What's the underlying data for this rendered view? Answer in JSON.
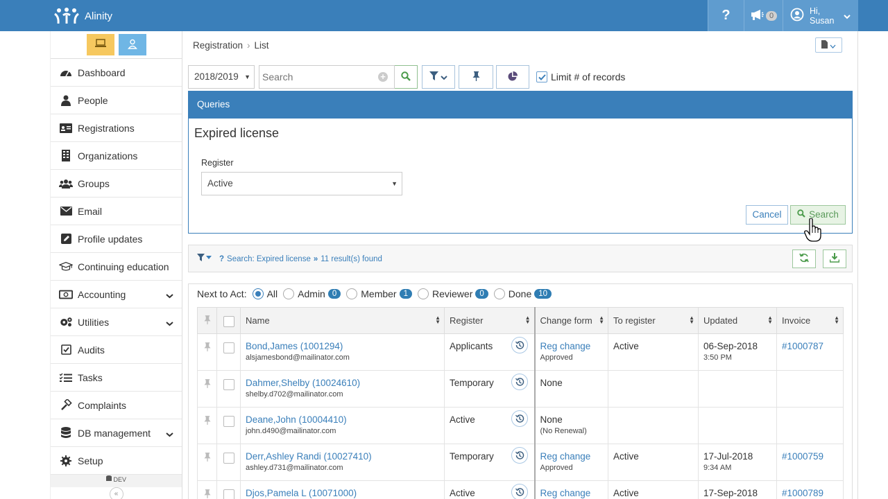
{
  "app": {
    "name": "Alinity"
  },
  "topbar": {
    "help_label": "?",
    "notif_count": "0",
    "user_greeting_1": "Hi,",
    "user_greeting_2": "Susan"
  },
  "sidebar": {
    "items": [
      {
        "label": "Dashboard",
        "icon": "dashboard-icon"
      },
      {
        "label": "People",
        "icon": "person-icon"
      },
      {
        "label": "Registrations",
        "icon": "id-card-icon"
      },
      {
        "label": "Organizations",
        "icon": "building-icon"
      },
      {
        "label": "Groups",
        "icon": "users-icon"
      },
      {
        "label": "Email",
        "icon": "envelope-icon"
      },
      {
        "label": "Profile updates",
        "icon": "edit-icon"
      },
      {
        "label": "Continuing education",
        "icon": "graduation-cap-icon"
      },
      {
        "label": "Accounting",
        "icon": "money-icon"
      },
      {
        "label": "Utilities",
        "icon": "cogs-icon"
      },
      {
        "label": "Audits",
        "icon": "check-square-icon"
      },
      {
        "label": "Tasks",
        "icon": "tasks-icon"
      },
      {
        "label": "Complaints",
        "icon": "gavel-icon"
      },
      {
        "label": "DB management",
        "icon": "database-icon"
      },
      {
        "label": "Setup",
        "icon": "gear-icon"
      }
    ],
    "env_label": "DEV",
    "collapse_label": "«"
  },
  "breadcrumb": {
    "root": "Registration",
    "current": "List"
  },
  "toolbar": {
    "year": "2018/2019",
    "search_placeholder": "Search",
    "limit_label": "Limit # of records"
  },
  "queries": {
    "header": "Queries",
    "title": "Expired license",
    "register_label": "Register",
    "register_value": "Active",
    "cancel_label": "Cancel",
    "search_label": "Search"
  },
  "result_bar": {
    "help": "?",
    "search_text": "Search: Expired license",
    "arrows": "»",
    "count_text": "11 result(s) found"
  },
  "next_to_act": {
    "label": "Next to Act:",
    "options": [
      {
        "label": "All",
        "count": ""
      },
      {
        "label": "Admin",
        "count": "0"
      },
      {
        "label": "Member",
        "count": "1"
      },
      {
        "label": "Reviewer",
        "count": "0"
      },
      {
        "label": "Done",
        "count": "10"
      }
    ]
  },
  "table": {
    "columns": [
      "Name",
      "Register",
      "Change form",
      "To register",
      "Updated",
      "Invoice"
    ],
    "rows": [
      {
        "name": "Bond,James (1001294)",
        "email": "alsjamesbond@mailinator.com",
        "register": "Applicants",
        "change": "Reg change",
        "change_sub": "Approved",
        "to_register": "Active",
        "updated": "06-Sep-2018",
        "updated_time": "3:50 PM",
        "invoice": "#1000787"
      },
      {
        "name": "Dahmer,Shelby (10024610)",
        "email": "shelby.d702@mailinator.com",
        "register": "Temporary",
        "change": "None",
        "change_sub": "",
        "to_register": "",
        "updated": "",
        "updated_time": "",
        "invoice": ""
      },
      {
        "name": "Deane,John (10004410)",
        "email": "john.d490@mailinator.com",
        "register": "Active",
        "change": "None",
        "change_sub": "(No Renewal)",
        "to_register": "",
        "updated": "",
        "updated_time": "",
        "invoice": ""
      },
      {
        "name": "Derr,Ashley Randi (10027410)",
        "email": "ashley.d731@mailinator.com",
        "register": "Temporary",
        "change": "Reg change",
        "change_sub": "Approved",
        "to_register": "Active",
        "updated": "17-Jul-2018",
        "updated_time": "9:34 AM",
        "invoice": "#1000759"
      },
      {
        "name": "Djos,Pamela L (10071000)",
        "email": "",
        "register": "Active",
        "change": "Reg change",
        "change_sub": "",
        "to_register": "Active",
        "updated": "17-Sep-2018",
        "updated_time": "",
        "invoice": "#1000789"
      }
    ]
  },
  "colors": {
    "brand": "#3a7fba",
    "topbar_btn": "#5f9ccf",
    "accent_green": "#5a9a5a"
  }
}
